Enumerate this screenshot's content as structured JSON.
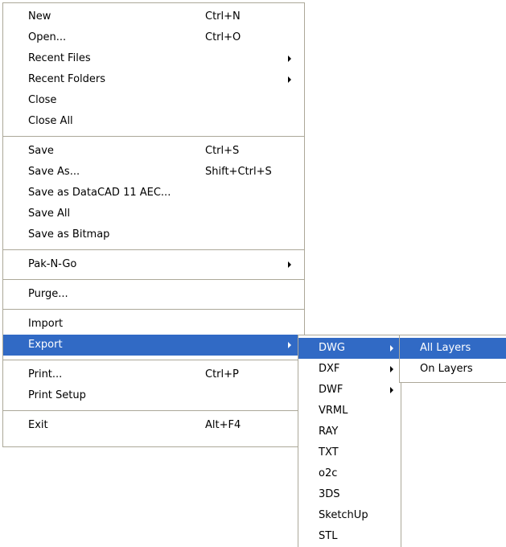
{
  "main_menu": {
    "groups": [
      [
        {
          "label": "New",
          "shortcut": "Ctrl+N"
        },
        {
          "label": "Open...",
          "shortcut": "Ctrl+O"
        },
        {
          "label": "Recent Files",
          "shortcut": ""
        },
        {
          "label": "Recent Folders",
          "shortcut": ""
        },
        {
          "label": "Close",
          "shortcut": ""
        },
        {
          "label": "Close All",
          "shortcut": ""
        }
      ],
      [
        {
          "label": "Save",
          "shortcut": "Ctrl+S"
        },
        {
          "label": "Save As...",
          "shortcut": "Shift+Ctrl+S"
        },
        {
          "label": "Save as DataCAD 11 AEC...",
          "shortcut": ""
        },
        {
          "label": "Save All",
          "shortcut": ""
        },
        {
          "label": "Save as Bitmap",
          "shortcut": ""
        }
      ],
      [
        {
          "label": "Pak-N-Go",
          "shortcut": ""
        }
      ],
      [
        {
          "label": "Purge...",
          "shortcut": ""
        }
      ],
      [
        {
          "label": "Import",
          "shortcut": ""
        },
        {
          "label": "Export",
          "shortcut": ""
        }
      ],
      [
        {
          "label": "Print...",
          "shortcut": "Ctrl+P"
        },
        {
          "label": "Print Setup",
          "shortcut": ""
        }
      ],
      [
        {
          "label": "Exit",
          "shortcut": "Alt+F4"
        }
      ]
    ],
    "submenu_items": [
      "Recent Files",
      "Recent Folders",
      "Pak-N-Go",
      "Export"
    ],
    "highlighted": "Export"
  },
  "export_submenu": {
    "items": [
      "DWG",
      "DXF",
      "DWF",
      "VRML",
      "RAY",
      "TXT",
      "o2c",
      "3DS",
      "SketchUp",
      "STL"
    ],
    "submenu_items": [
      "DWG",
      "DXF",
      "DWF"
    ],
    "highlighted": "DWG"
  },
  "dwg_submenu": {
    "items": [
      "All Layers",
      "On Layers"
    ],
    "highlighted": "All Layers"
  },
  "colors": {
    "highlight": "#316ac5",
    "border": "#aca899",
    "background": "#ffffff"
  }
}
